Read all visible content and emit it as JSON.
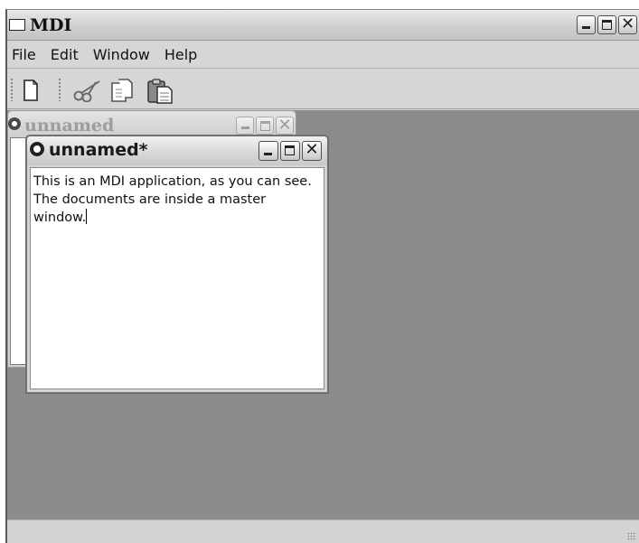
{
  "app": {
    "title": "MDI"
  },
  "menu": [
    "File",
    "Edit",
    "Window",
    "Help"
  ],
  "toolbar": {
    "tools": [
      "new-document-icon",
      "cut-icon",
      "copy-icon",
      "paste-icon"
    ]
  },
  "windows": {
    "back": {
      "title": "unnamed"
    },
    "front": {
      "title": "unnamed*",
      "text_lines": [
        "This is an MDI application, as you can see.",
        "The documents are inside a master",
        "window."
      ]
    }
  },
  "window_buttons": {
    "minimize": "minimize-icon",
    "maximize": "maximize-icon",
    "close": "close-icon"
  }
}
